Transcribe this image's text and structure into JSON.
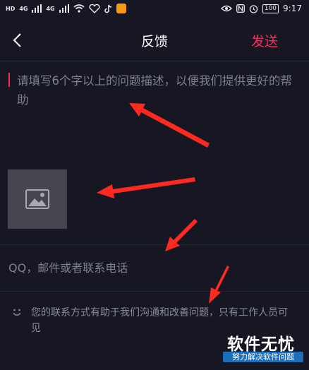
{
  "status_bar": {
    "left_tags": [
      "HD",
      "4G",
      "4G"
    ],
    "battery": "100",
    "time": "9:17"
  },
  "header": {
    "title": "反馈",
    "send_label": "发送"
  },
  "feedback": {
    "description_placeholder": "请填写6个字以上的问题描述，以便我们提供更好的帮助"
  },
  "contact": {
    "placeholder": "QQ，邮件或者联系电话"
  },
  "notice": {
    "text": "您的联系方式有助于我们沟通和改善问题，只有工作人员可见"
  },
  "watermark": {
    "title": "软件无忧",
    "subtitle": "努力解决软件问题"
  },
  "colors": {
    "background": "#161722",
    "accent": "#fe2c55",
    "placeholder": "#7f8090",
    "arrow": "#ff2a1f"
  }
}
